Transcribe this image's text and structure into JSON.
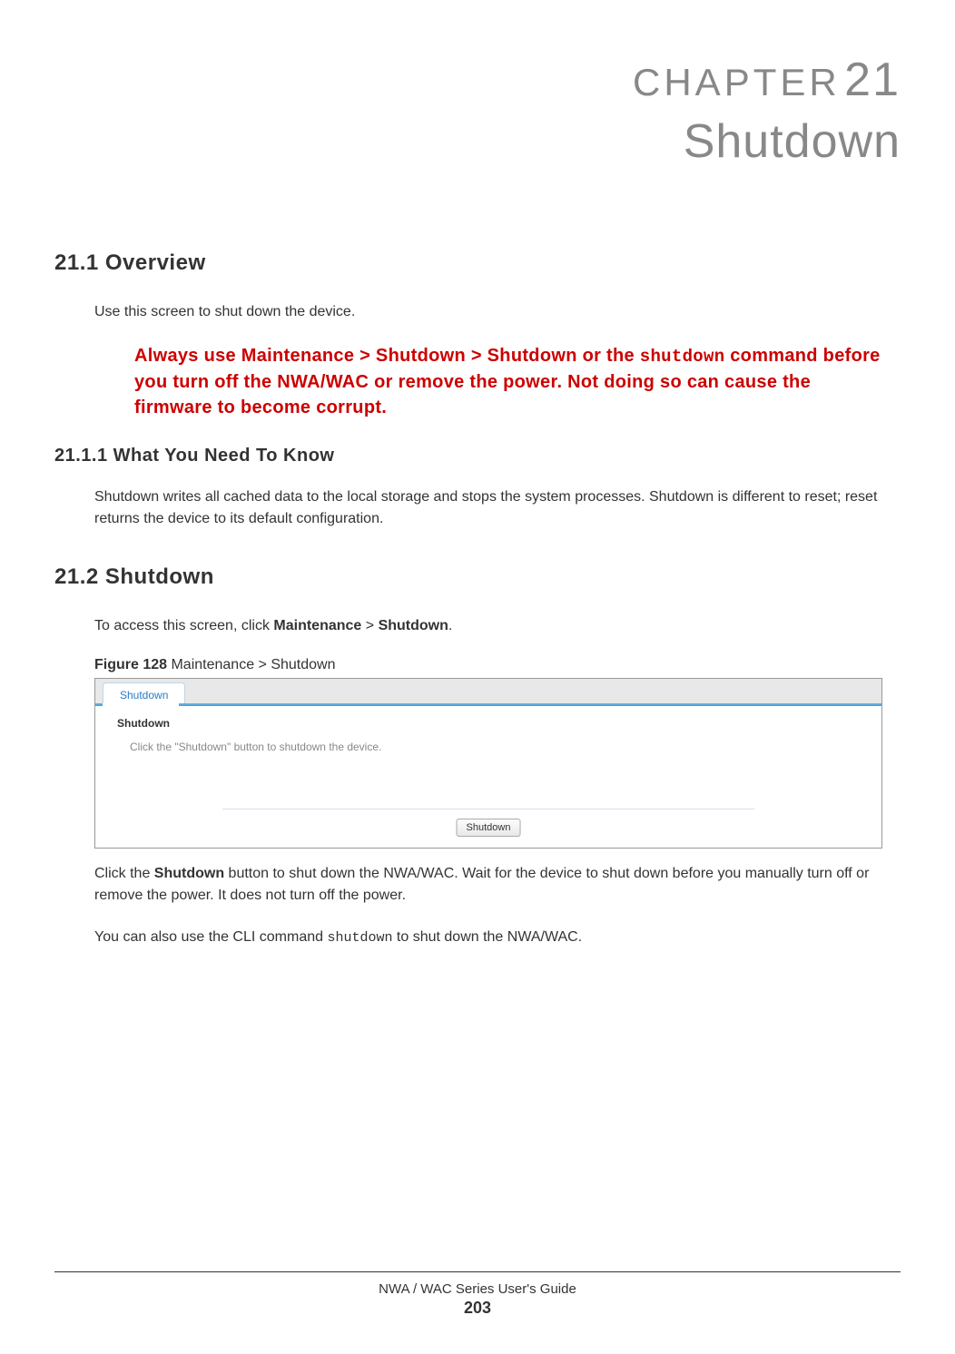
{
  "chapter": {
    "label_prefix": "C",
    "label_rest": "HAPTER",
    "number": "21",
    "title": "Shutdown"
  },
  "sections": {
    "overview": {
      "heading": "21.1  Overview",
      "intro": "Use this screen to shut down the device.",
      "warning_pre": "Always use Maintenance > Shutdown > Shutdown or the ",
      "warning_code": "shutdown",
      "warning_post": " command before you turn off the NWA/WAC or remove the power. Not doing so can cause the firmware to become corrupt.",
      "subsection": {
        "heading": "21.1.1  What You Need To Know",
        "text": "Shutdown writes all cached data to the local storage and stops the system processes. Shutdown is different to reset; reset returns the device to its default configuration."
      }
    },
    "shutdown": {
      "heading": "21.2  Shutdown",
      "access_pre": "To access this screen, click ",
      "access_bold1": "Maintenance",
      "access_mid": " > ",
      "access_bold2": "Shutdown",
      "access_post": ".",
      "figure_label": "Figure 128",
      "figure_caption": "   Maintenance > Shutdown",
      "screenshot": {
        "tab_label": "Shutdown",
        "panel_title": "Shutdown",
        "instruction": "Click the \"Shutdown\" button to shutdown the device.",
        "button_label": "Shutdown"
      },
      "after_fig_pre": "Click the ",
      "after_fig_bold": "Shutdown",
      "after_fig_post": " button to shut down the NWA/WAC. Wait for the device to shut down before you manually turn off or remove the power. It does not turn off the power.",
      "cli_pre": "You can also use the CLI command ",
      "cli_code": "shutdown",
      "cli_post": " to shut down the NWA/WAC."
    }
  },
  "footer": {
    "guide": "NWA / WAC Series User's Guide",
    "page": "203"
  }
}
